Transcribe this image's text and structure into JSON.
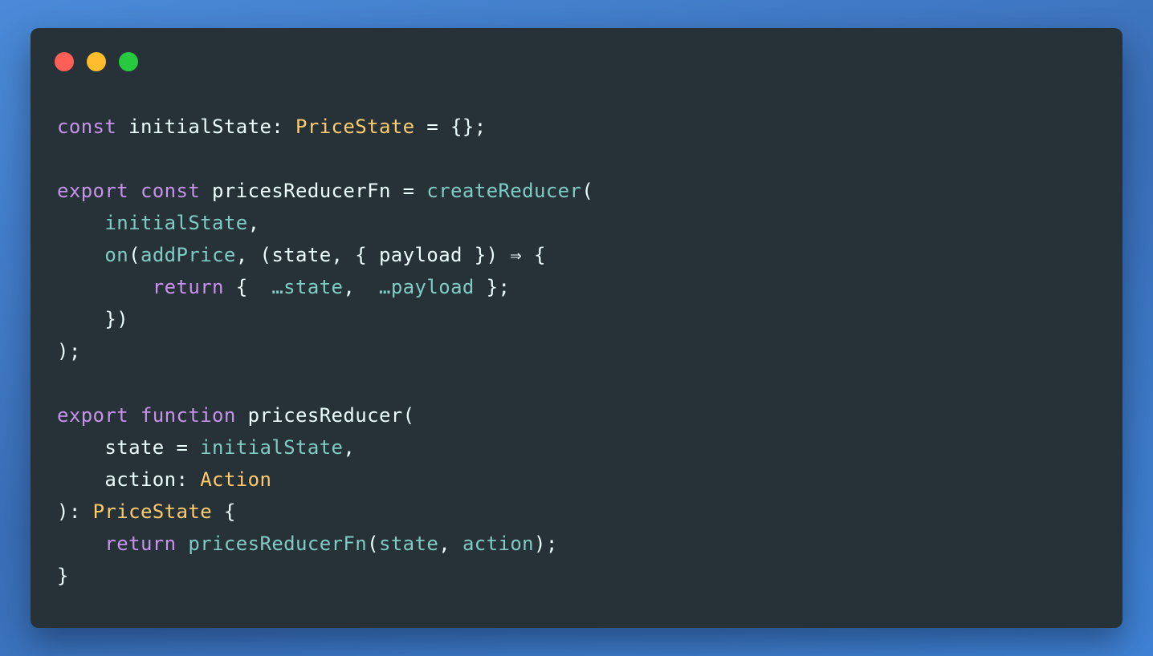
{
  "window": {
    "controls": [
      {
        "name": "close",
        "color": "#ff5f56"
      },
      {
        "name": "minimize",
        "color": "#ffbd2e"
      },
      {
        "name": "maximize",
        "color": "#27c93f"
      }
    ]
  },
  "code": {
    "language": "typescript",
    "lines": [
      [
        {
          "t": "kw",
          "v": "const"
        },
        {
          "t": "id",
          "v": " initialState: "
        },
        {
          "t": "ty",
          "v": "PriceState"
        },
        {
          "t": "pn",
          "v": " = {};"
        }
      ],
      [],
      [
        {
          "t": "kw",
          "v": "export const"
        },
        {
          "t": "id",
          "v": " pricesReducerFn = "
        },
        {
          "t": "fn",
          "v": "createReducer"
        },
        {
          "t": "pn",
          "v": "("
        }
      ],
      [
        {
          "t": "pn",
          "v": "    "
        },
        {
          "t": "fn",
          "v": "initialState"
        },
        {
          "t": "pn",
          "v": ","
        }
      ],
      [
        {
          "t": "pn",
          "v": "    "
        },
        {
          "t": "fn",
          "v": "on"
        },
        {
          "t": "pn",
          "v": "("
        },
        {
          "t": "fn",
          "v": "addPrice"
        },
        {
          "t": "pn",
          "v": ", (state, { payload }) ⇒ {"
        }
      ],
      [
        {
          "t": "pn",
          "v": "        "
        },
        {
          "t": "kw",
          "v": "return"
        },
        {
          "t": "pn",
          "v": " {  "
        },
        {
          "t": "fn",
          "v": "…state"
        },
        {
          "t": "pn",
          "v": ",  "
        },
        {
          "t": "fn",
          "v": "…payload"
        },
        {
          "t": "pn",
          "v": " };"
        }
      ],
      [
        {
          "t": "pn",
          "v": "    })"
        }
      ],
      [
        {
          "t": "pn",
          "v": ");"
        }
      ],
      [],
      [
        {
          "t": "kw",
          "v": "export function"
        },
        {
          "t": "id",
          "v": " pricesReducer("
        }
      ],
      [
        {
          "t": "pn",
          "v": "    state = "
        },
        {
          "t": "fn",
          "v": "initialState"
        },
        {
          "t": "pn",
          "v": ","
        }
      ],
      [
        {
          "t": "pn",
          "v": "    action: "
        },
        {
          "t": "ty",
          "v": "Action"
        }
      ],
      [
        {
          "t": "pn",
          "v": "): "
        },
        {
          "t": "ty",
          "v": "PriceState"
        },
        {
          "t": "pn",
          "v": " {"
        }
      ],
      [
        {
          "t": "pn",
          "v": "    "
        },
        {
          "t": "kw",
          "v": "return"
        },
        {
          "t": "pn",
          "v": " "
        },
        {
          "t": "fn",
          "v": "pricesReducerFn"
        },
        {
          "t": "pn",
          "v": "("
        },
        {
          "t": "fn",
          "v": "state"
        },
        {
          "t": "pn",
          "v": ", "
        },
        {
          "t": "fn",
          "v": "action"
        },
        {
          "t": "pn",
          "v": ");"
        }
      ],
      [
        {
          "t": "pn",
          "v": "}"
        }
      ]
    ]
  }
}
